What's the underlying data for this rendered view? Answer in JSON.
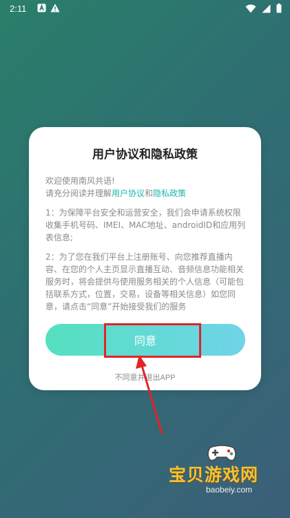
{
  "status_bar": {
    "time": "2:11",
    "icons_left": [
      "a-notification-icon",
      "warning-icon"
    ],
    "icons_right": [
      "wifi-icon",
      "cellular-signal-icon",
      "battery-icon"
    ]
  },
  "dialog": {
    "title": "用户协议和隐私政策",
    "welcome": "欢迎使用南风共语!",
    "read_prefix": "请充分阅读并理解",
    "user_agreement_link": "用户协议",
    "and": "和",
    "privacy_policy_link": "隐私政策",
    "para1": "1：为保障平台安全和运营安全，我们会申请系统权限收集手机号码、IMEI、MAC地址、androidID和应用列表信息;",
    "para2": "2：为了您在我们平台上注册账号、向您推荐直播内容、在您的个人主页显示直播互动、音频信息功能相关服务时，将会提供与使用服务相关的个人信息（可能包括联系方式，位置，交易，设备等相关信息）如您同意，请点击“同意”开始接受我们的服务",
    "agree_button": "同意",
    "disagree_link": "不同意并退出APP"
  },
  "watermark": {
    "title": "宝贝游戏网",
    "url": "baobeiy.com"
  },
  "colors": {
    "link": "#18b8a8",
    "highlight": "#e02427",
    "button_start": "#55e0c0",
    "button_end": "#6fd4e8"
  }
}
